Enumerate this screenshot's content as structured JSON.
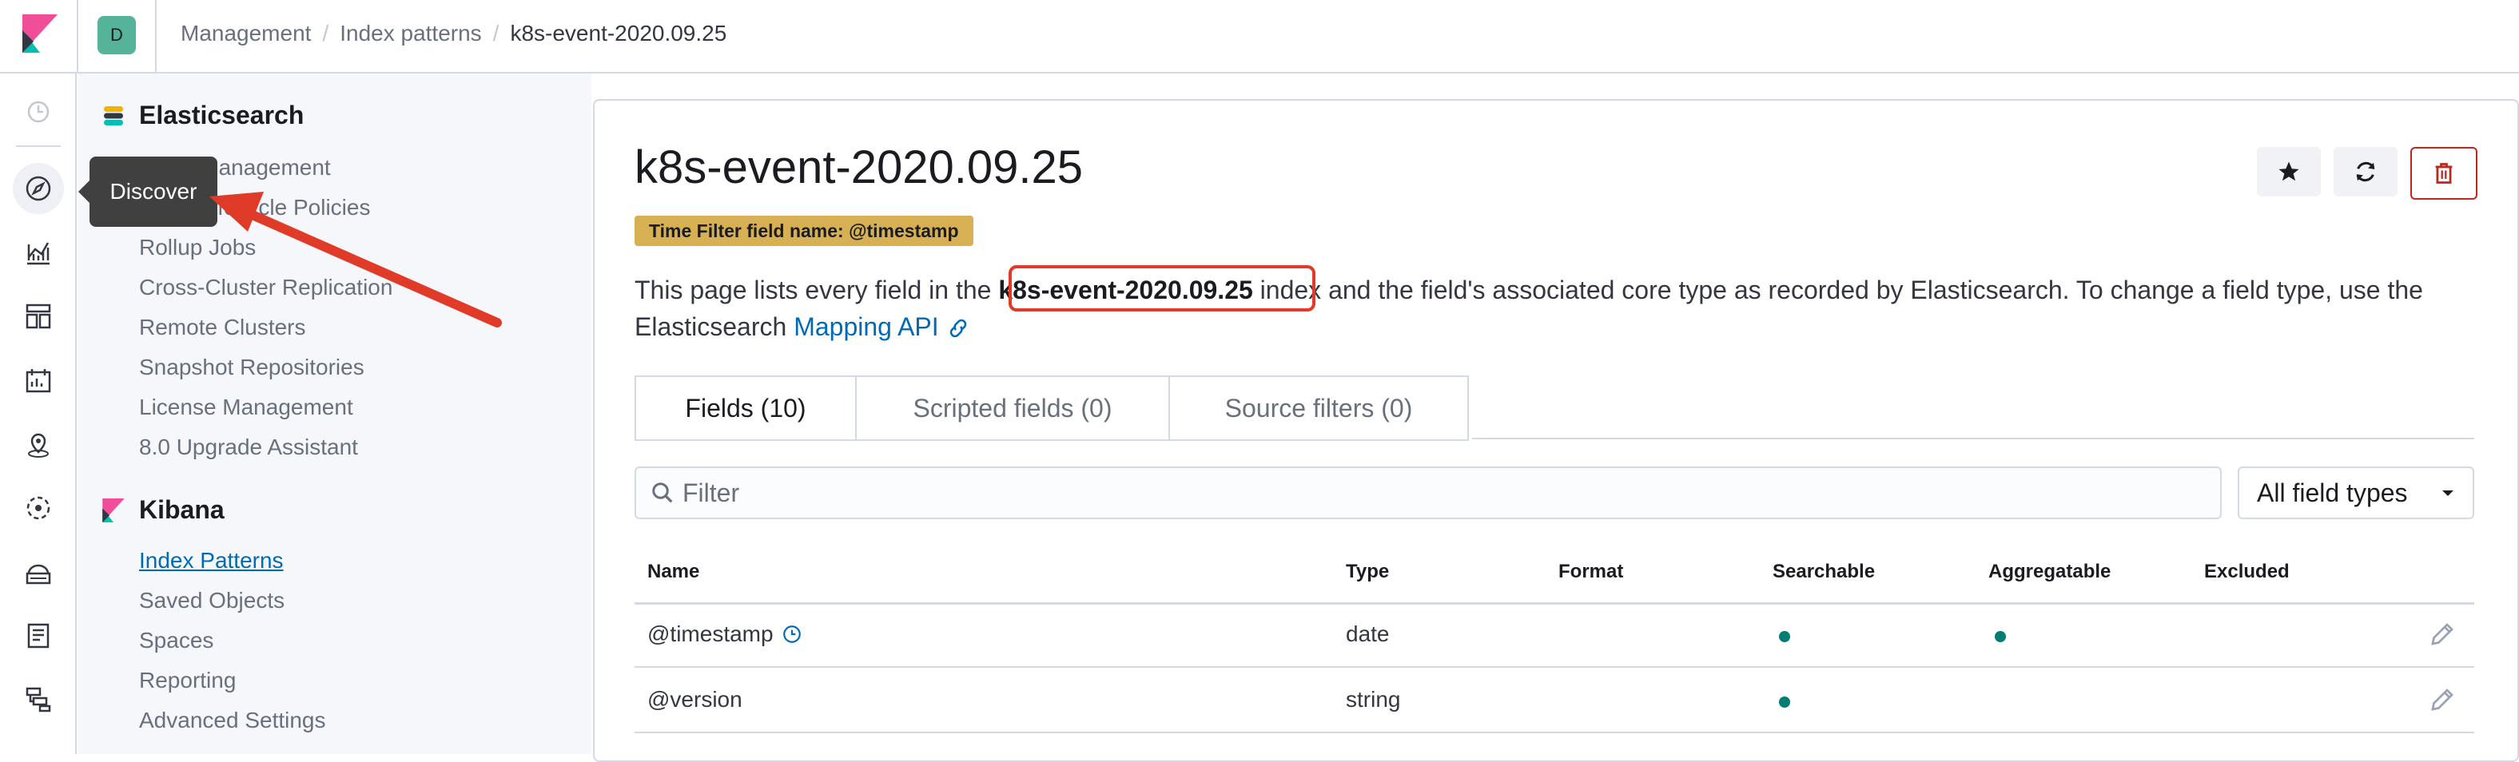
{
  "header": {
    "space_initial": "D",
    "breadcrumbs": [
      "Management",
      "Index patterns",
      "k8s-event-2020.09.25"
    ],
    "breadcrumb_sep": "/"
  },
  "rail": {
    "icons": [
      "recent-clock-icon",
      "discover-compass-icon",
      "visualize-icon",
      "dashboard-icon",
      "canvas-icon",
      "maps-icon",
      "machine-learning-icon",
      "infrastructure-icon",
      "logs-icon",
      "apm-icon"
    ]
  },
  "tooltip": {
    "text": "Discover"
  },
  "sidebar": {
    "sections": [
      {
        "title": "Elasticsearch",
        "items": [
          {
            "label": "Index Management"
          },
          {
            "label": "Index Lifecycle Policies"
          },
          {
            "label": "Rollup Jobs"
          },
          {
            "label": "Cross-Cluster Replication"
          },
          {
            "label": "Remote Clusters"
          },
          {
            "label": "Snapshot Repositories"
          },
          {
            "label": "License Management"
          },
          {
            "label": "8.0 Upgrade Assistant"
          }
        ]
      },
      {
        "title": "Kibana",
        "items": [
          {
            "label": "Index Patterns",
            "active": true
          },
          {
            "label": "Saved Objects"
          },
          {
            "label": "Spaces"
          },
          {
            "label": "Reporting"
          },
          {
            "label": "Advanced Settings"
          }
        ]
      }
    ]
  },
  "main": {
    "title": "k8s-event-2020.09.25",
    "time_filter_badge": "Time Filter field name: @timestamp",
    "description": {
      "before": "This page lists every field in the ",
      "index_name": "k8s-event-2020.09.25",
      "after": " index and the field's associated core type as recorded by Elasticsearch. To change a field type, use the Elasticsearch ",
      "link": "Mapping API"
    },
    "tabs": [
      {
        "label": "Fields (10)",
        "active": true
      },
      {
        "label": "Scripted fields (0)"
      },
      {
        "label": "Source filters (0)"
      }
    ],
    "filter_placeholder": "Filter",
    "field_type_select": "All field types",
    "table": {
      "columns": [
        "Name",
        "Type",
        "Format",
        "Searchable",
        "Aggregatable",
        "Excluded"
      ],
      "rows": [
        {
          "name": "@timestamp",
          "time_field": true,
          "type": "date",
          "format": "",
          "searchable": true,
          "aggregatable": true,
          "excluded": false
        },
        {
          "name": "@version",
          "time_field": false,
          "type": "string",
          "format": "",
          "searchable": true,
          "aggregatable": false,
          "excluded": false
        }
      ]
    }
  },
  "colors": {
    "accent": "#006bb4",
    "badge": "#d6b052",
    "danger": "#bd271e",
    "success_dot": "#017d73",
    "annotation": "#e03b29"
  }
}
